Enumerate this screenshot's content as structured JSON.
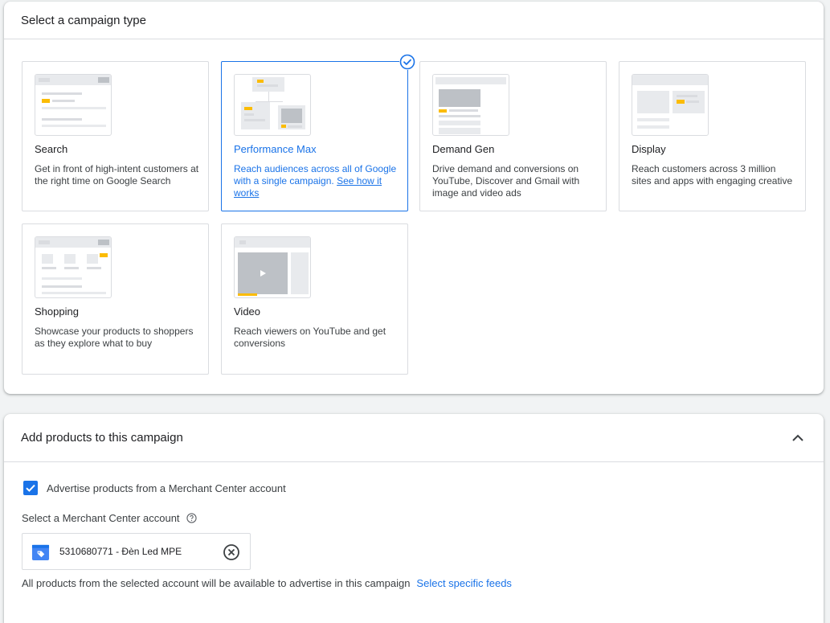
{
  "campaign_type": {
    "header": "Select a campaign type",
    "cards": [
      {
        "title": "Search",
        "desc": "Get in front of high-intent customers at the right time on Google Search"
      },
      {
        "title": "Performance Max",
        "desc": "Reach audiences across all of Google with a single campaign.",
        "link": "See how it works"
      },
      {
        "title": "Demand Gen",
        "desc": "Drive demand and conversions on YouTube, Discover and Gmail with image and video ads"
      },
      {
        "title": "Display",
        "desc": "Reach customers across 3 million sites and apps with engaging creative"
      },
      {
        "title": "Shopping",
        "desc": "Showcase your products to shoppers as they explore what to buy"
      },
      {
        "title": "Video",
        "desc": "Reach viewers on YouTube and get conversions"
      }
    ],
    "selected": "Performance Max"
  },
  "products": {
    "header": "Add products to this campaign",
    "checkbox_label": "Advertise products from a Merchant Center account",
    "checkbox_checked": true,
    "account_label": "Select a Merchant Center account",
    "account_value": "5310680771 - Đèn Led MPE",
    "footer_text": "All products from the selected account will be available to advertise in this campaign",
    "footer_link": "Select specific feeds"
  },
  "colors": {
    "accent": "#1a73e8",
    "highlight": "#fbbc04",
    "border": "#dadce0"
  },
  "icons": [
    "check-circle-icon",
    "chevron-up-icon",
    "checkmark-icon",
    "help-icon",
    "merchant-center-icon",
    "clear-icon",
    "play-icon"
  ]
}
